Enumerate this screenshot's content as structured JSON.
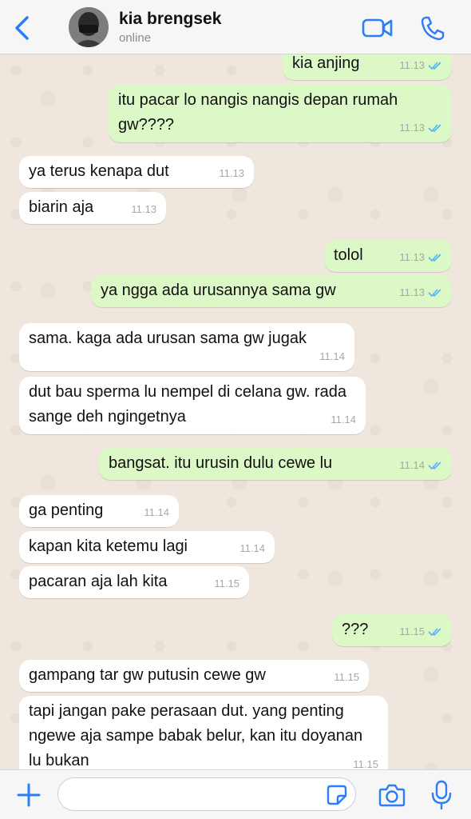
{
  "header": {
    "contact_name": "kia brengsek",
    "status": "online",
    "accent_color": "#2c7df6"
  },
  "messages": [
    {
      "dir": "out",
      "text": "kia anjing",
      "time": "11.13",
      "read": true
    },
    {
      "dir": "out",
      "text": "itu pacar lo nangis nangis depan rumah gw????",
      "time": "11.13",
      "read": true
    },
    {
      "dir": "in",
      "text": "ya terus kenapa dut",
      "time": "11.13"
    },
    {
      "dir": "in",
      "text": "biarin aja",
      "time": "11.13"
    },
    {
      "dir": "out",
      "text": "tolol",
      "time": "11.13",
      "read": true
    },
    {
      "dir": "out",
      "text": "ya ngga ada urusannya sama gw",
      "time": "11.13",
      "read": true
    },
    {
      "dir": "in",
      "text": "sama. kaga ada urusan sama gw jugak",
      "time": "11.14"
    },
    {
      "dir": "in",
      "text": "dut bau sperma lu nempel di celana gw. rada sange deh ngingetnya",
      "time": "11.14"
    },
    {
      "dir": "out",
      "text": "bangsat. itu urusin dulu cewe lu",
      "time": "11.14",
      "read": true
    },
    {
      "dir": "in",
      "text": "ga penting",
      "time": "11.14"
    },
    {
      "dir": "in",
      "text": "kapan kita ketemu lagi",
      "time": "11.14"
    },
    {
      "dir": "in",
      "text": "pacaran aja lah kita",
      "time": "11.15"
    },
    {
      "dir": "out",
      "text": "???",
      "time": "11.15",
      "read": true
    },
    {
      "dir": "in",
      "text": "gampang tar gw putusin cewe gw",
      "time": "11.15"
    },
    {
      "dir": "in",
      "text": "tapi jangan pake perasaan dut. yang penting ngewe aja sampe babak belur, kan itu doyanan lu bukan",
      "time": "11.15"
    }
  ],
  "input": {
    "value": "",
    "placeholder": ""
  },
  "icons": {
    "back": "chevron-left-icon",
    "video": "video-camera-icon",
    "call": "phone-icon",
    "attach": "plus-icon",
    "sticker": "sticker-icon",
    "camera": "camera-icon",
    "mic": "microphone-icon"
  }
}
